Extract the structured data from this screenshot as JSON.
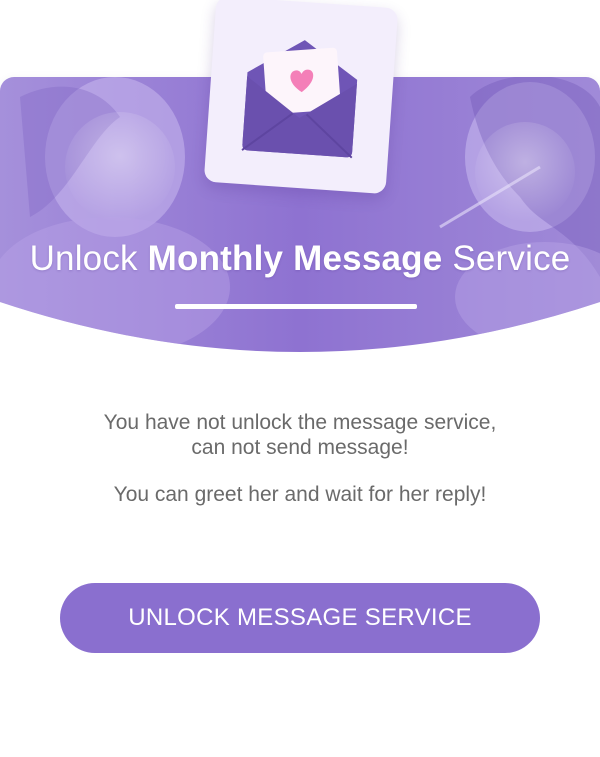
{
  "header": {
    "title_prefix": "Unlock ",
    "title_bold": "Monthly Message",
    "title_suffix": " Service"
  },
  "message": {
    "line1": "You have not unlock the message service,",
    "line2": "can not send message!",
    "line3": "You can greet her and wait for her reply!"
  },
  "button": {
    "label": "UNLOCK MESSAGE SERVICE"
  },
  "icons": {
    "envelope": "envelope-heart-icon"
  },
  "colors": {
    "accent": "#8a6fcf",
    "header": "#9478d6",
    "text": "#6a6a6a"
  }
}
